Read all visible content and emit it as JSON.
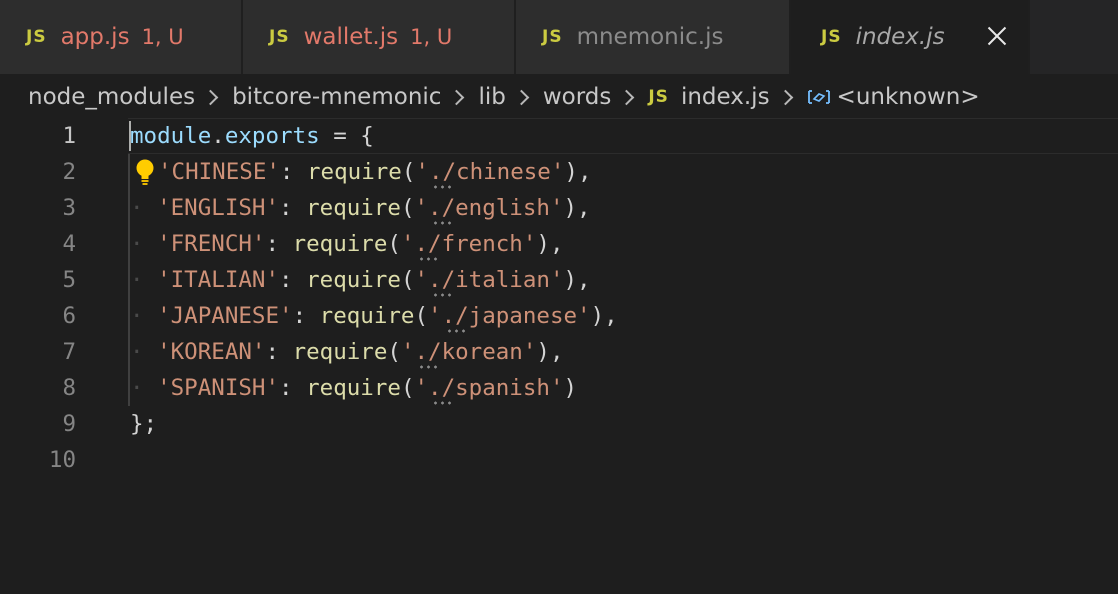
{
  "tabs": [
    {
      "label": "app.js",
      "badge": "1, U",
      "icon": "JS",
      "state": "modified"
    },
    {
      "label": "wallet.js",
      "badge": "1, U",
      "icon": "JS",
      "state": "modified"
    },
    {
      "label": "mnemonic.js",
      "badge": "",
      "icon": "JS",
      "state": "normal"
    },
    {
      "label": "index.js",
      "badge": "",
      "icon": "JS",
      "state": "active"
    }
  ],
  "breadcrumb": {
    "segments": [
      "node_modules",
      "bitcore-mnemonic",
      "lib",
      "words"
    ],
    "file": "index.js",
    "file_icon": "JS",
    "symbol": "<unknown>",
    "symbol_icon": "symbol-variable-icon"
  },
  "editor": {
    "lines": [
      {
        "n": "1"
      },
      {
        "n": "2",
        "key": "'CHINESE'",
        "path": "./chinese",
        "trail": "),"
      },
      {
        "n": "3",
        "key": "'ENGLISH'",
        "path": "./english",
        "trail": "),"
      },
      {
        "n": "4",
        "key": "'FRENCH'",
        "path": "./french",
        "trail": "),"
      },
      {
        "n": "5",
        "key": "'ITALIAN'",
        "path": "./italian",
        "trail": "),"
      },
      {
        "n": "6",
        "key": "'JAPANESE'",
        "path": "./japanese",
        "trail": "),"
      },
      {
        "n": "7",
        "key": "'KOREAN'",
        "path": "./korean",
        "trail": "),"
      },
      {
        "n": "8",
        "key": "'SPANISH'",
        "path": "./spanish",
        "trail": ")"
      },
      {
        "n": "9"
      },
      {
        "n": "10"
      }
    ],
    "line1": {
      "obj": "module",
      "dot": ".",
      "prop": "exports",
      "rest": " = {"
    },
    "line9": "};",
    "require_fn": "require",
    "colon": ":",
    "open_paren": "(",
    "quote": "'"
  },
  "colors": {
    "background": "#1e1e1e",
    "tab_inactive": "#2d2d2d",
    "js_icon": "#cbcb41",
    "modified_text": "#e2796a",
    "string": "#ce9178",
    "function": "#dcdcaa",
    "property": "#9cdcfe",
    "line_number": "#858585",
    "lightbulb": "#ffcc00"
  }
}
